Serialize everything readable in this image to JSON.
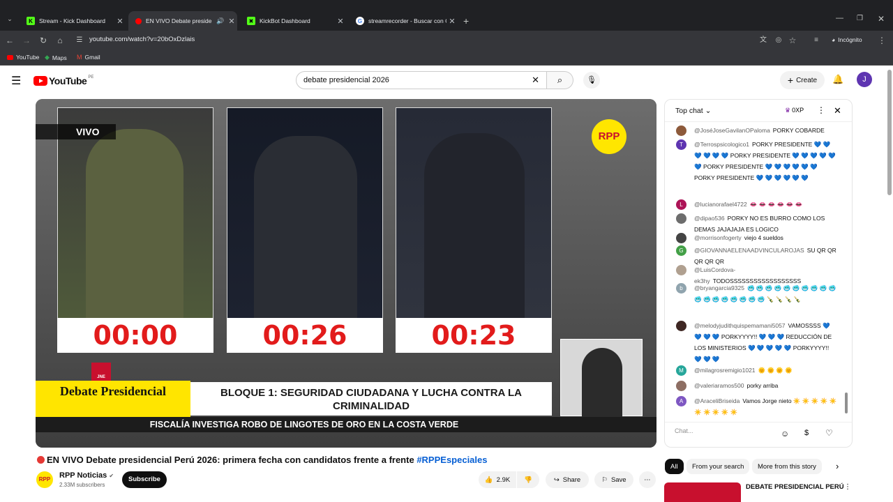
{
  "browser": {
    "tabs": [
      {
        "title": "Stream - Kick Dashboard",
        "icon": "kick-icon"
      },
      {
        "title": "EN VIVO Debate preside",
        "icon": "youtube-icon"
      },
      {
        "title": "KickBot Dashboard",
        "icon": "kickbot-icon"
      },
      {
        "title": "streamrecorder - Buscar con Go",
        "icon": "google-icon"
      }
    ],
    "url": "youtube.com/watch?v=20bOxDzlais",
    "profile_label": "Incógnito",
    "bookmarks": [
      "YouTube",
      "Maps",
      "Gmail"
    ]
  },
  "youtube": {
    "region": "PE",
    "logo_text": "YouTube",
    "search_value": "debate presidencial 2026",
    "create_label": "Create",
    "avatar_letter": "J"
  },
  "video": {
    "vivo_label": "VIVO",
    "timers": [
      "00:00",
      "00:26",
      "00:23"
    ],
    "logo": "RPP",
    "jne": "JNE",
    "debate_title": "Debate Presidencial",
    "bloque_text": "BLOQUE 1: SEGURIDAD CIUDADANA Y LUCHA CONTRA LA CRIMINALIDAD",
    "ticker": "FISCALÍA INVESTIGA ROBO DE LINGOTES DE ORO EN LA COSTA VERDE",
    "title": "EN VIVO Debate presidencial Perú 2026: primera fecha con candidatos frente a frente",
    "hashtag": "#RPPEspeciales",
    "channel": "RPP Noticias",
    "subscribers": "2.33M subscribers",
    "subscribe_label": "Subscribe",
    "likes": "2.9K",
    "share_label": "Share",
    "save_label": "Save"
  },
  "chat": {
    "header": "Top chat",
    "xp": "0XP",
    "input_placeholder": "Chat...",
    "messages": [
      {
        "author": "@JoséJoseGavilanOPaloma",
        "text": "PORKY COBARDE",
        "avatar_letter": "",
        "avatar_color": "#8d5a3b"
      },
      {
        "author": "@Terrospsicologico1",
        "text": "PORKY PRESIDENTE 💙 💙 💙 💙 💙 💙 PORKY PRESIDENTE 💙 💙 💙 💙 💙 💙 PORKY PRESIDENTE 💙 💙 💙 💙 💙 💙 PORKY PRESIDENTE 💙 💙 💙 💙 💙 💙",
        "avatar_letter": "T",
        "avatar_color": "#5e35b1"
      },
      {
        "author": "@lucianorafael4722",
        "text": "👄 👄 👄 👄 👄 👄",
        "avatar_letter": "L",
        "avatar_color": "#ad1457"
      },
      {
        "author": "@dipao536",
        "text": "PORKY NO ES BURRO COMO LOS DEMAS JAJAJAJA ES LOGICO",
        "avatar_letter": "",
        "avatar_color": "#6d6d6d"
      },
      {
        "author": "@morrisonfogerty",
        "text": "viejo 4 sueldos",
        "avatar_letter": "",
        "avatar_color": "#444444"
      },
      {
        "author": "@GIOVANNAELENAADVINCULAROJAS",
        "text": "SU QR QR QR QR QR",
        "avatar_letter": "G",
        "avatar_color": "#43a047"
      },
      {
        "author": "@LuisCordova-ek3hy",
        "text": "TODOSSSSSSSSSSSSSSSSSS",
        "avatar_letter": "",
        "avatar_color": "#b0a090"
      },
      {
        "author": "@bryangarcia9325",
        "text": "🥶 🥶 🥶 🥶 🥶 🥶 🥶 🥶 🥶 🥶 🥶 🥶 🥶 🥶 🥶 🥶 🥶 🥶 🍾 🍾 🍾 🍾",
        "avatar_letter": "b",
        "avatar_color": "#90a4ae"
      },
      {
        "author": "@melodyjudithquispemamani5057",
        "text": "VAMOSSSS 💙 💙 💙 💙 PORKYYYY!! 💙 💙 💙 REDUCCIÓN DE LOS MINISTERIOS 💙 💙 💙 💙 💙 PORKYYYY!! 💙 💙 💙",
        "avatar_letter": "",
        "avatar_color": "#3e2723"
      },
      {
        "author": "@milagrosremigio1021",
        "text": "🌞 🌞 🌞 🌞",
        "avatar_letter": "M",
        "avatar_color": "#26a69a"
      },
      {
        "author": "@valeriaramos500",
        "text": "porky arriba",
        "avatar_letter": "",
        "avatar_color": "#8d6e63"
      },
      {
        "author": "@AraceliBriseida",
        "text": "Vamos Jorge nieto ☀️ ☀️ ☀️ ☀️ ☀️ ☀️ ☀️ ☀️ ☀️ ☀️",
        "avatar_letter": "A",
        "avatar_color": "#7e57c2"
      }
    ]
  },
  "sidebar_chips": [
    "All",
    "From your search",
    "More from this story"
  ],
  "recommended_title": "DEBATE PRESIDENCIAL PERÚ"
}
